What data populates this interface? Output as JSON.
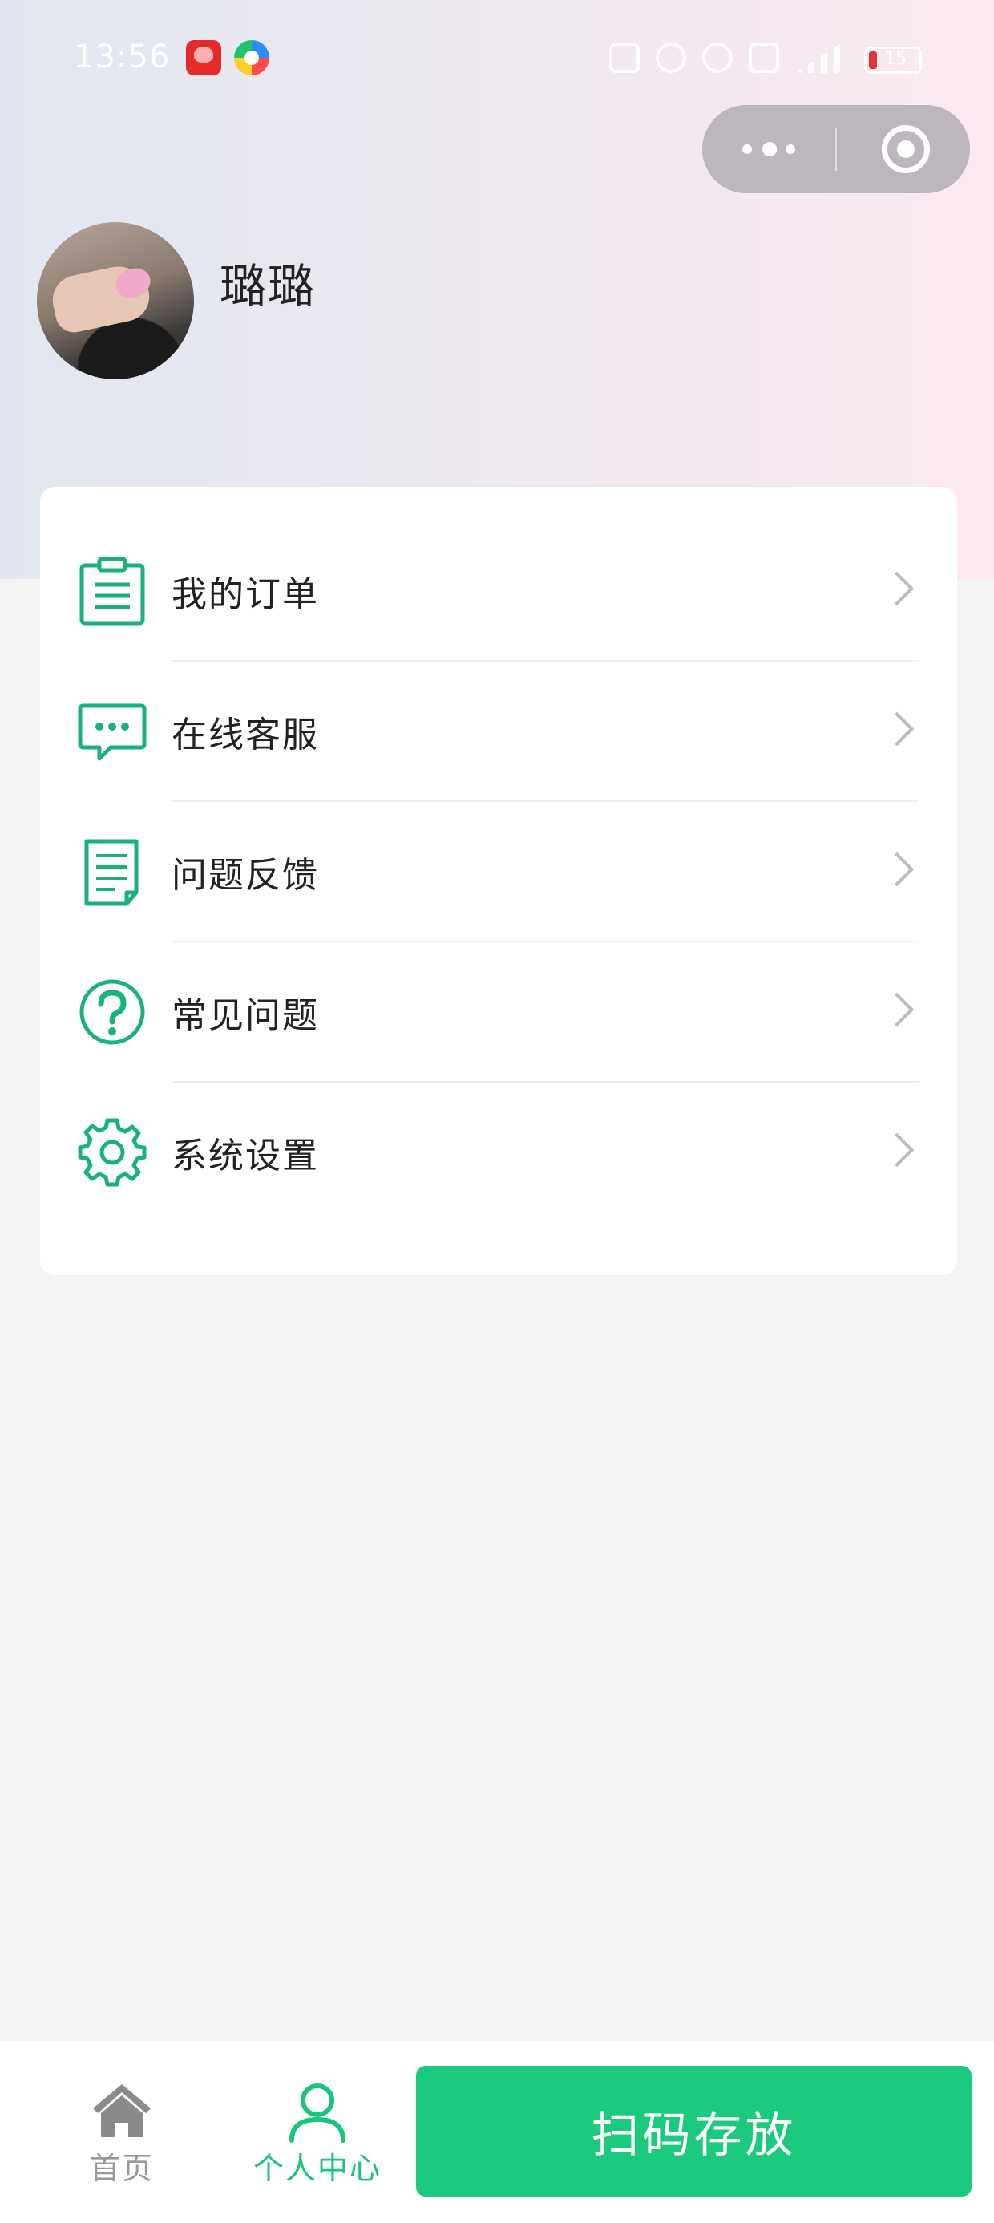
{
  "status_bar": {
    "time": "13:56",
    "app_icons": [
      "pinduoduo-app-icon",
      "multicolor-app-icon"
    ],
    "system_icons": [
      "nfc-icon",
      "headphones-icon",
      "alarm-icon",
      "hd-icon",
      "signal-5g-icon"
    ],
    "battery_level": "15"
  },
  "capsule": {
    "more_icon": "more-dots-icon",
    "close_icon": "target-close-icon"
  },
  "profile": {
    "username": "璐璐"
  },
  "menu": {
    "items": [
      {
        "label": "我的订单",
        "icon": "clipboard-icon"
      },
      {
        "label": "在线客服",
        "icon": "chat-bubble-icon"
      },
      {
        "label": "问题反馈",
        "icon": "document-icon"
      },
      {
        "label": "常见问题",
        "icon": "question-circle-icon"
      },
      {
        "label": "系统设置",
        "icon": "gear-icon"
      }
    ]
  },
  "bottom_nav": {
    "tabs": [
      {
        "label": "首页",
        "icon": "home-icon",
        "active": false
      },
      {
        "label": "个人中心",
        "icon": "person-icon",
        "active": true
      }
    ],
    "scan_button_label": "扫码存放"
  },
  "colors": {
    "accent": "#1bc47d",
    "button": "#1bca7d",
    "background": "#f4f4f4",
    "card": "#ffffff"
  }
}
